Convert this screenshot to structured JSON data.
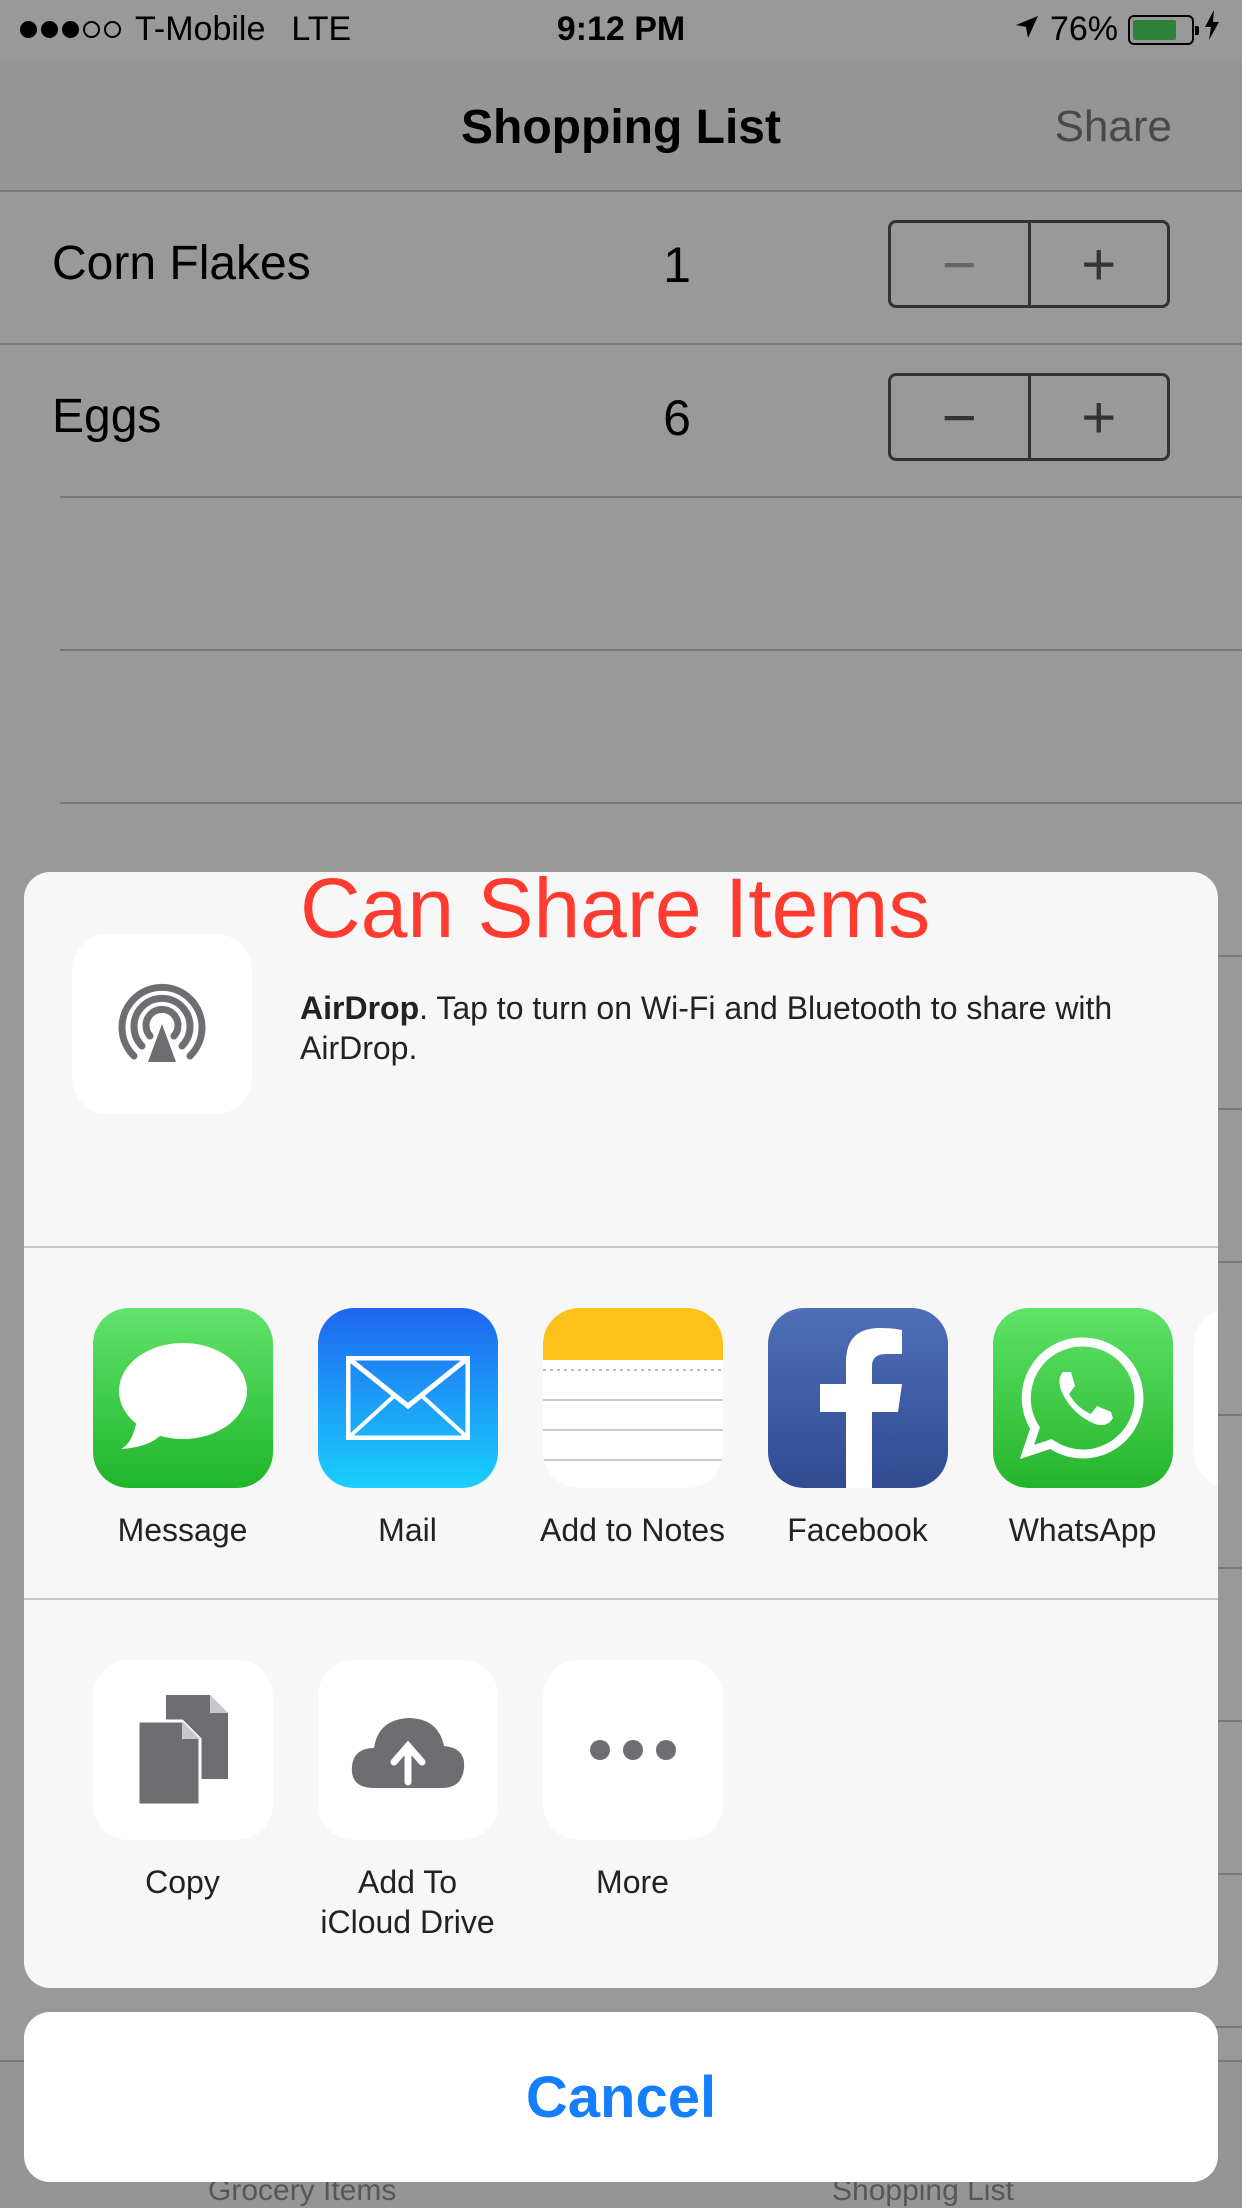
{
  "status_bar": {
    "carrier": "T-Mobile",
    "network": "LTE",
    "time": "9:12 PM",
    "battery_percent": "76%",
    "battery_level": 0.76,
    "signal_bars": 3
  },
  "nav": {
    "title": "Shopping List",
    "share_label": "Share"
  },
  "items": [
    {
      "name": "Corn Flakes",
      "quantity": "1",
      "minus": "−",
      "plus": "+"
    },
    {
      "name": "Eggs",
      "quantity": "6",
      "minus": "−",
      "plus": "+"
    }
  ],
  "annotation": "Can Share Items",
  "share_sheet": {
    "airdrop_title": "AirDrop",
    "airdrop_text": ". Tap to turn on Wi-Fi and Bluetooth to share with AirDrop.",
    "apps": [
      {
        "label": "Message",
        "icon": "message-icon"
      },
      {
        "label": "Mail",
        "icon": "mail-icon"
      },
      {
        "label": "Add to Notes",
        "icon": "notes-icon"
      },
      {
        "label": "Facebook",
        "icon": "facebook-icon"
      },
      {
        "label": "WhatsApp",
        "icon": "whatsapp-icon"
      }
    ],
    "actions": [
      {
        "label": "Copy",
        "icon": "copy-icon"
      },
      {
        "label": "Add To\niCloud Drive",
        "icon": "icloud-upload-icon"
      },
      {
        "label": "More",
        "icon": "more-icon"
      }
    ],
    "cancel_label": "Cancel"
  },
  "tab_bar": {
    "left": "Grocery Items",
    "right": "Shopping List"
  },
  "colors": {
    "accent": "#157efb",
    "annotation": "#ff3b30",
    "battery": "#4cd964"
  }
}
